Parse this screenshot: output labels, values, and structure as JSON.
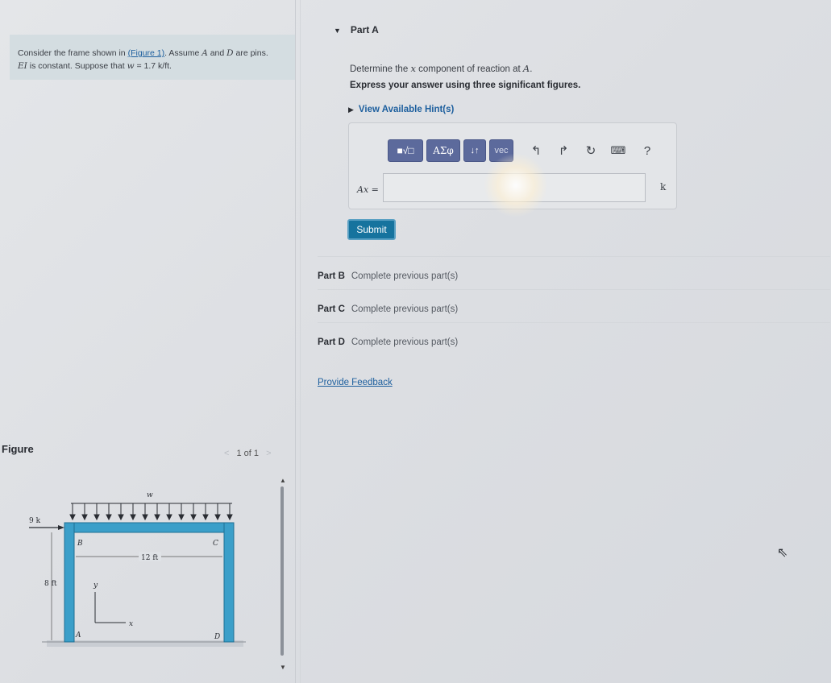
{
  "problem": {
    "intro": "Consider the frame shown in ",
    "figure_link": "(Figure 1)",
    "after_link": ". Assume ",
    "a_var": "A",
    "and_text": " and ",
    "d_var": "D",
    "pins_text": " are pins.",
    "ei_var": "EI",
    "line2": " is constant. Suppose that ",
    "w_eq": "w",
    "w_value": " = 1.7 k/ft."
  },
  "figure": {
    "label": "Figure",
    "page": "1 of 1",
    "prev_icon": "<",
    "next_icon": ">",
    "load_label": "w",
    "force_label": "9 k",
    "height_label": "8 ft",
    "span_label": "12 ft",
    "node_a": "A",
    "node_b": "B",
    "node_c": "C",
    "node_d": "D",
    "axis_x": "x",
    "axis_y": "y"
  },
  "part_a": {
    "title": "Part A",
    "question_pre": "Determine the ",
    "question_var": "x",
    "question_post": " component of reaction at ",
    "question_pt": "A",
    "question_end": ".",
    "instructions": "Express your answer using three significant figures.",
    "hints": "View Available Hint(s)",
    "answer_label": "Ax =",
    "answer_value": "",
    "unit": "k",
    "submit": "Submit",
    "toolbar": {
      "templates": "■√□",
      "greek": "ΑΣφ",
      "arrows": "↓↑",
      "vec": "vec",
      "undo_icon": "↰",
      "redo_icon": "↱",
      "reset_icon": "↻",
      "keyboard_icon": "⌨",
      "help_icon": "?"
    }
  },
  "parts": [
    {
      "label": "Part B",
      "status": "Complete previous part(s)"
    },
    {
      "label": "Part C",
      "status": "Complete previous part(s)"
    },
    {
      "label": "Part D",
      "status": "Complete previous part(s)"
    }
  ],
  "feedback": "Provide Feedback"
}
